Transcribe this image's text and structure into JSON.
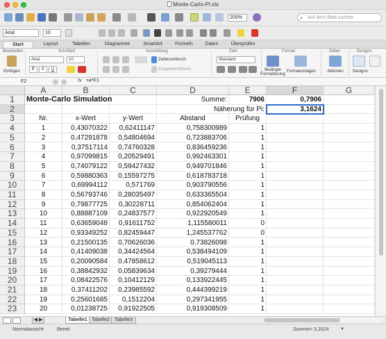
{
  "window": {
    "title": "Monte-Carlo-Pi.xls"
  },
  "toolbar": {
    "zoom": "200%",
    "search_placeholder": "Auf dem Blatt suchen"
  },
  "format_toolbar": {
    "font": "Arial",
    "size": "10"
  },
  "ribbon_tabs": [
    "Start",
    "Layout",
    "Tabellen",
    "Diagramme",
    "SmartArt",
    "Formeln",
    "Daten",
    "Überprüfen"
  ],
  "ribbon": {
    "groups": {
      "bearbeiten": "Bearbeiten",
      "schriftart": "Schriftart",
      "ausrichtung": "Ausrichtung",
      "zahl": "Zahl",
      "format": "Format",
      "zellen": "Zellen",
      "designs": "Designs"
    },
    "paste_label": "Einfügen",
    "font_name": "Arial",
    "font_size": "10",
    "wrap_label": "Zeilenumbruch",
    "merge_label": "Zusammenführen",
    "number_format": "Standard",
    "cond_format_label": "Bedingte Formatierung",
    "formatvorlagen_label": "Formatvorlagen",
    "aktionen_label": "Aktionen",
    "designs_label": "Designs",
    "bold": "F",
    "italic": "K",
    "underline": "U"
  },
  "formula_bar": {
    "name_box": "F2",
    "fx": "fx",
    "formula": "=4*F1"
  },
  "columns": [
    "A",
    "B",
    "C",
    "D",
    "E",
    "F",
    "G"
  ],
  "rows": [
    "1",
    "2",
    "3",
    "4",
    "5",
    "6",
    "7",
    "8",
    "9",
    "10",
    "11",
    "12",
    "13",
    "14",
    "15",
    "16",
    "17",
    "18",
    "19",
    "20",
    "21",
    "22",
    "23"
  ],
  "sheet": {
    "title": "Monte-Carlo Simulation",
    "summe_label": "Summe:",
    "summe_count": "7906",
    "summe_ratio": "0,7906",
    "pi_label": "Näherung für Pi:",
    "pi_value": "3,1624",
    "headers": [
      "Nr.",
      "x-Wert",
      "y-Wert",
      "Abstand",
      "Prüfung"
    ],
    "data": [
      [
        "1",
        "0,43070322",
        "0,62411147",
        "0,758300989",
        "1"
      ],
      [
        "2",
        "0,47291878",
        "0,54804694",
        "0,723883706",
        "1"
      ],
      [
        "3",
        "0,37517114",
        "0,74760328",
        "0,836459236",
        "1"
      ],
      [
        "4",
        "0,97099815",
        "0,20529491",
        "0,992463301",
        "1"
      ],
      [
        "5",
        "0,74079122",
        "0,59427432",
        "0,949701846",
        "1"
      ],
      [
        "6",
        "0,59880363",
        "0,15597275",
        "0,618783718",
        "1"
      ],
      [
        "7",
        "0,69994112",
        "0,571769",
        "0,903790556",
        "1"
      ],
      [
        "8",
        "0,56793746",
        "0,28035497",
        "0,633365504",
        "1"
      ],
      [
        "9",
        "0,79877725",
        "0,30228711",
        "0,854062404",
        "1"
      ],
      [
        "10",
        "0,88887109",
        "0,24837577",
        "0,922920549",
        "1"
      ],
      [
        "11",
        "0,63659048",
        "0,91611752",
        "1,115580011",
        "0"
      ],
      [
        "12",
        "0,93349252",
        "0,82459447",
        "1,245537762",
        "0"
      ],
      [
        "13",
        "0,21500135",
        "0,70626036",
        "0,73826098",
        "1"
      ],
      [
        "14",
        "0,41409038",
        "0,34424564",
        "0,538494109",
        "1"
      ],
      [
        "15",
        "0,20090584",
        "0,47858612",
        "0,519045113",
        "1"
      ],
      [
        "16",
        "0,38842932",
        "0,05839634",
        "0,39279444",
        "1"
      ],
      [
        "17",
        "0,08422576",
        "0,10412129",
        "0,133922445",
        "1"
      ],
      [
        "18",
        "0,37411202",
        "0,23985592",
        "0,444399219",
        "1"
      ],
      [
        "19",
        "0,25601685",
        "0,1512204",
        "0,297341955",
        "1"
      ],
      [
        "20",
        "0,01238725",
        "0,91922505",
        "0,919308509",
        "1"
      ]
    ]
  },
  "sheet_tabs": [
    "Tabelle1",
    "Tabelle2",
    "Tabelle3"
  ],
  "status": {
    "view": "Normalansicht",
    "mode": "Bereit",
    "sum": "Summe= 3,1624"
  }
}
